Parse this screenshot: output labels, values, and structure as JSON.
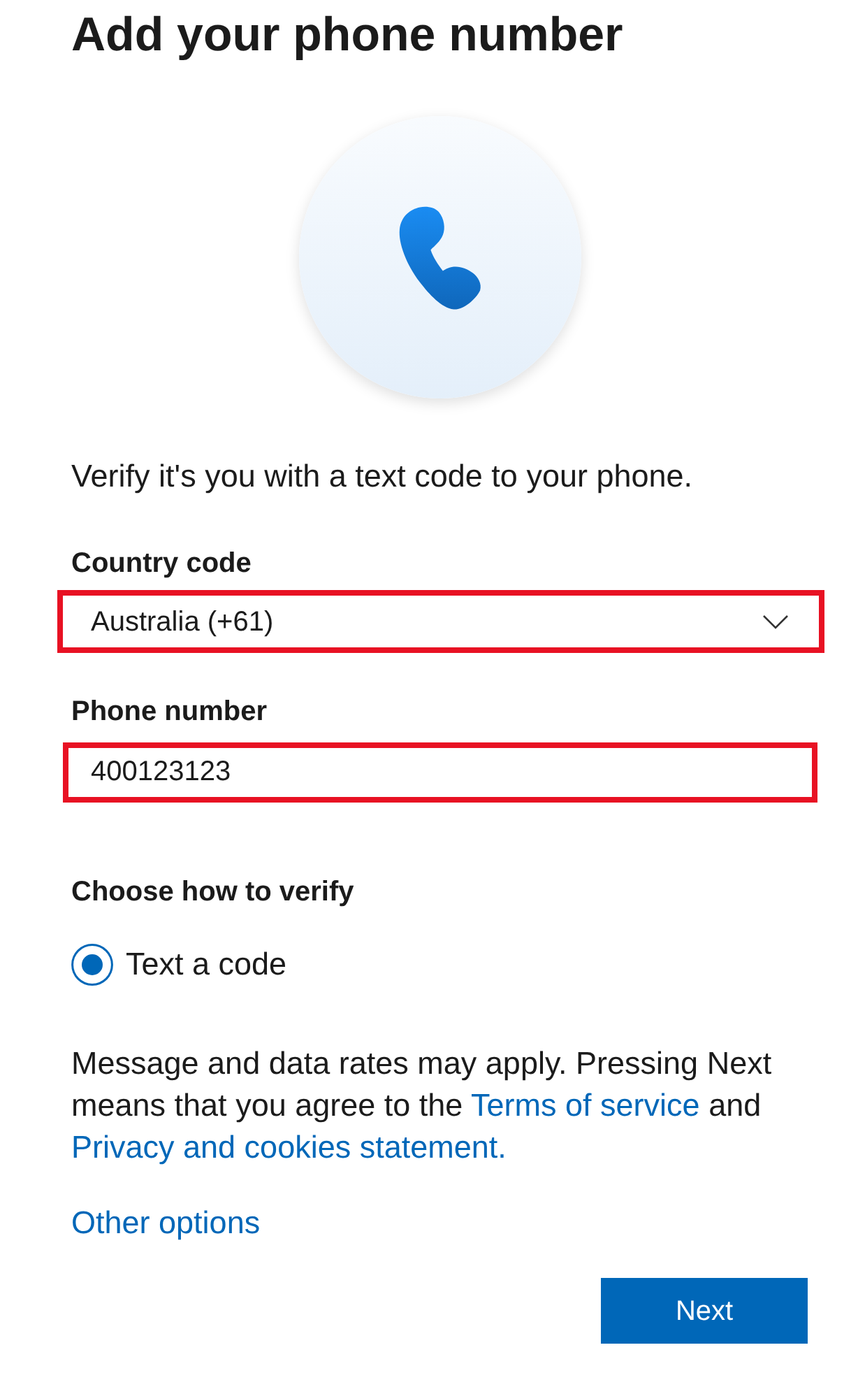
{
  "title": "Add your phone number",
  "description": "Verify it's you with a text code to your phone.",
  "fields": [
    {
      "kind": "select",
      "label": "Country code",
      "value": "Australia (+61)",
      "highlighted": true
    },
    {
      "kind": "input",
      "label": "Phone number",
      "value": "400123123",
      "highlighted": true
    }
  ],
  "verify": {
    "label": "Choose how to verify",
    "options": [
      {
        "label": "Text a code",
        "selected": true
      }
    ]
  },
  "notice": [
    {
      "kind": "text",
      "text": "Message and data rates may apply. Pressing Next means that you agree to the "
    },
    {
      "kind": "link",
      "text": "Terms of service"
    },
    {
      "kind": "text",
      "text": " and "
    },
    {
      "kind": "link",
      "text": "Privacy and cookies statement."
    }
  ],
  "other_options": "Other options",
  "buttons": [
    {
      "kind": "primary",
      "label": "Next"
    }
  ]
}
